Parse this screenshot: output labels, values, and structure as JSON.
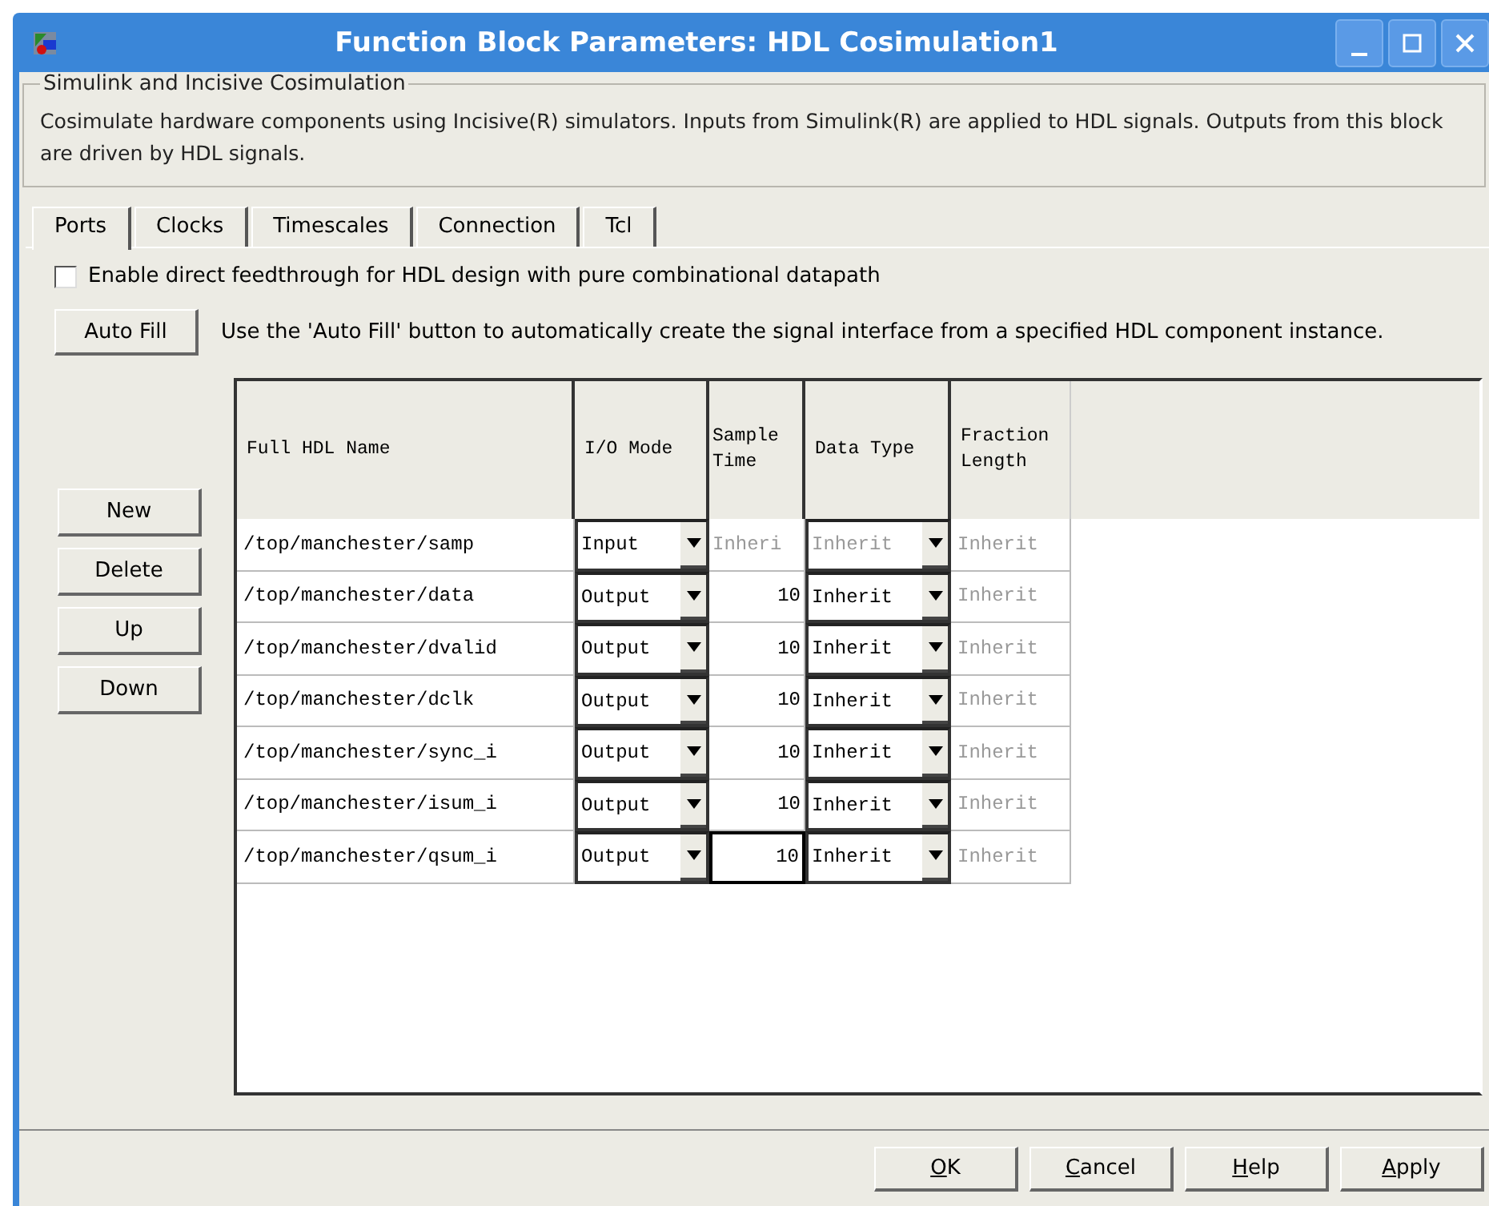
{
  "window": {
    "title": "Function Block Parameters: HDL Cosimulation1"
  },
  "group": {
    "title": "Simulink and Incisive Cosimulation",
    "description": "Cosimulate hardware components using Incisive(R) simulators.  Inputs from Simulink(R) are applied to HDL signals.  Outputs from this block are driven by HDL signals."
  },
  "tabs": [
    {
      "label": "Ports",
      "selected": true
    },
    {
      "label": "Clocks",
      "selected": false
    },
    {
      "label": "Timescales",
      "selected": false
    },
    {
      "label": "Connection",
      "selected": false
    },
    {
      "label": "Tcl",
      "selected": false
    }
  ],
  "feedthrough": {
    "label": "Enable direct feedthrough for HDL design with pure combinational datapath",
    "checked": false
  },
  "auto_fill": {
    "button": "Auto Fill",
    "hint": "Use the 'Auto Fill' button to automatically create the signal interface from a specified HDL component instance."
  },
  "side_buttons": [
    "New",
    "Delete",
    "Up",
    "Down"
  ],
  "table": {
    "columns": [
      "Full HDL Name",
      "I/O Mode",
      "Sample Time",
      "Data Type",
      "Fraction Length"
    ],
    "rows": [
      {
        "name": "/top/manchester/samp",
        "io_mode": "Input",
        "sample_time": "Inheri",
        "sample_disabled": true,
        "sample_focused": false,
        "data_type": "Inherit",
        "data_type_disabled": true,
        "fraction_length": "Inherit"
      },
      {
        "name": "/top/manchester/data",
        "io_mode": "Output",
        "sample_time": "10",
        "sample_disabled": false,
        "sample_focused": false,
        "data_type": "Inherit",
        "data_type_disabled": false,
        "fraction_length": "Inherit"
      },
      {
        "name": "/top/manchester/dvalid",
        "io_mode": "Output",
        "sample_time": "10",
        "sample_disabled": false,
        "sample_focused": false,
        "data_type": "Inherit",
        "data_type_disabled": false,
        "fraction_length": "Inherit"
      },
      {
        "name": "/top/manchester/dclk",
        "io_mode": "Output",
        "sample_time": "10",
        "sample_disabled": false,
        "sample_focused": false,
        "data_type": "Inherit",
        "data_type_disabled": false,
        "fraction_length": "Inherit"
      },
      {
        "name": "/top/manchester/sync_i",
        "io_mode": "Output",
        "sample_time": "10",
        "sample_disabled": false,
        "sample_focused": false,
        "data_type": "Inherit",
        "data_type_disabled": false,
        "fraction_length": "Inherit"
      },
      {
        "name": "/top/manchester/isum_i",
        "io_mode": "Output",
        "sample_time": "10",
        "sample_disabled": false,
        "sample_focused": false,
        "data_type": "Inherit",
        "data_type_disabled": false,
        "fraction_length": "Inherit"
      },
      {
        "name": "/top/manchester/qsum_i",
        "io_mode": "Output",
        "sample_time": "10",
        "sample_disabled": false,
        "sample_focused": true,
        "data_type": "Inherit",
        "data_type_disabled": false,
        "fraction_length": "Inherit"
      }
    ]
  },
  "buttons": [
    "OK",
    "Cancel",
    "Help",
    "Apply"
  ]
}
